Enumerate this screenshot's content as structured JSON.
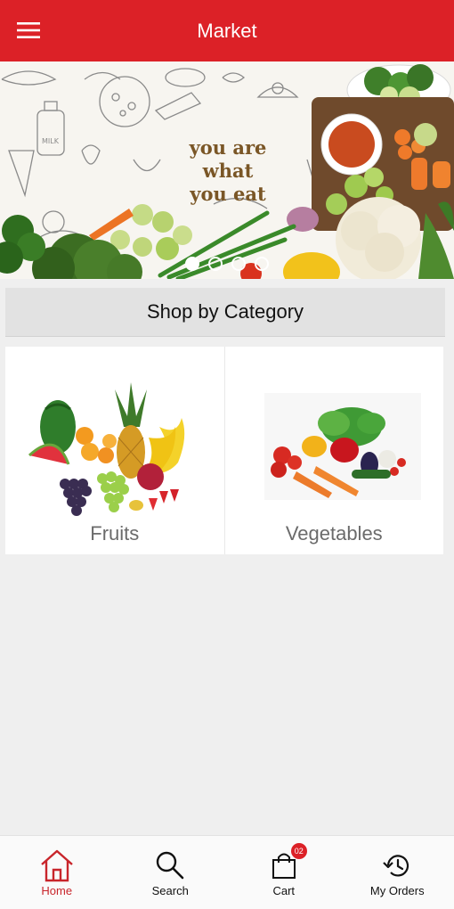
{
  "app_bar": {
    "title": "Market",
    "menu_icon": "hamburger-menu-icon",
    "background": "#dc2127"
  },
  "banner": {
    "slogan_lines": [
      "you are",
      "what",
      "you eat"
    ],
    "slide_count": 4,
    "active_slide": 1
  },
  "categories": {
    "header": "Shop by Category",
    "items": [
      {
        "label": "Fruits",
        "icon": "fruits-image"
      },
      {
        "label": "Vegetables",
        "icon": "vegetables-image"
      }
    ]
  },
  "bottom_nav": {
    "active": "Home",
    "accent": "#c8252b",
    "items": [
      {
        "label": "Home",
        "icon": "home-icon"
      },
      {
        "label": "Search",
        "icon": "search-icon"
      },
      {
        "label": "Cart",
        "icon": "cart-icon",
        "badge": "02"
      },
      {
        "label": "My Orders",
        "icon": "history-icon"
      }
    ]
  }
}
